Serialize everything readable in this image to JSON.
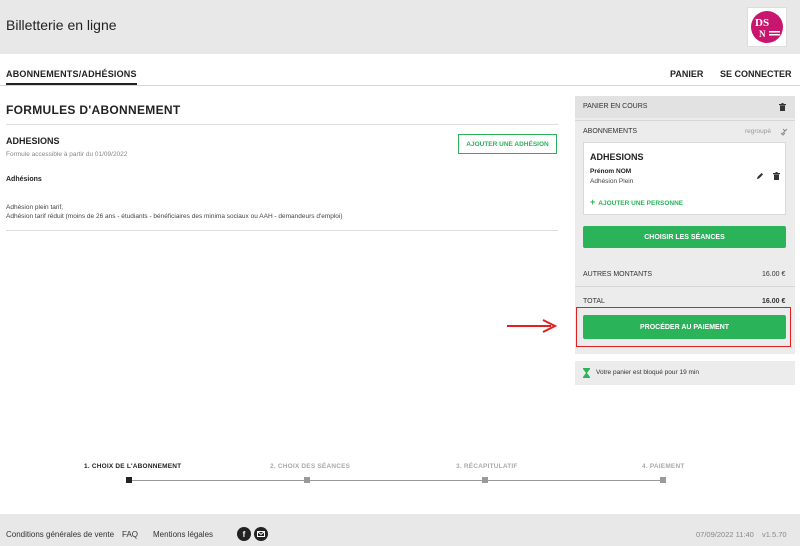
{
  "header": {
    "title": "Billetterie en ligne",
    "logo_icon": "dsn-logo"
  },
  "nav": {
    "tab": "ABONNEMENTS/ADHÉSIONS",
    "panier": "PANIER",
    "connect": "SE CONNECTER"
  },
  "main": {
    "title": "FORMULES D'ABONNEMENT",
    "section_title": "ADHESIONS",
    "available_from": "Formule accessible à partir du 01/09/2022",
    "add_button": "AJOUTER UNE ADHÉSION",
    "label": "Adhésions",
    "desc_line1": "Adhésion plein tarif,",
    "desc_line2": "Adhésion tarif réduit (moins de 26 ans - étudiants - bénéficiaires des minima sociaux ou AAH - demandeurs d'emploi)"
  },
  "cart": {
    "header": "PANIER EN COURS",
    "abonnements": "ABONNEMENTS",
    "grouped": "regroupé",
    "card_title": "ADHESIONS",
    "person_name": "Prénom NOM",
    "person_tariff": "Adhésion Plein",
    "add_person": "AJOUTER UNE PERSONNE",
    "choose_button": "CHOISIR LES SÉANCES",
    "other_amounts_label": "AUTRES MONTANTS",
    "other_amounts_value": "16.00 €",
    "total_label": "TOTAL",
    "total_value": "16.00 €",
    "pay_button": "PROCÉDER AU PAIEMENT",
    "timer_text": "Votre panier est bloqué pour 19 min"
  },
  "steps": {
    "s1": "1. CHOIX DE L'ABONNEMENT",
    "s2": "2. CHOIX DES SÉANCES",
    "s3": "3. RÉCAPITULATIF",
    "s4": "4. PAIEMENT",
    "current": 1
  },
  "footer": {
    "cgv": "Conditions générales de vente",
    "faq": "FAQ",
    "legal": "Mentions légales",
    "datetime": "07/09/2022 11:40",
    "version": "v1.5.70"
  },
  "colors": {
    "accent_green": "#2bb35a",
    "highlight_red": "#e02020",
    "logo_magenta": "#c8166f"
  }
}
